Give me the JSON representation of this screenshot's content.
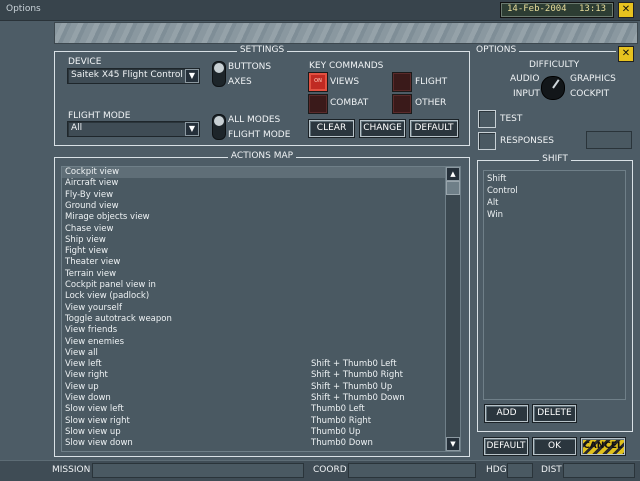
{
  "window": {
    "title": "Options",
    "date": "14-Feb-2004",
    "time": "13:13",
    "close_label": "✕"
  },
  "settings": {
    "title": "SETTINGS",
    "device_label": "DEVICE",
    "device_value": "Saitek X45 Flight Controller",
    "flight_mode_label": "FLIGHT MODE",
    "flight_mode_value": "All",
    "buttons_label": "BUTTONS",
    "axes_label": "AXES",
    "all_modes_label": "ALL MODES",
    "flight_mode_toggle_label": "FLIGHT MODE",
    "key_commands_label": "KEY COMMANDS",
    "on_label": "ON",
    "views_label": "VIEWS",
    "flight_label": "FLIGHT",
    "combat_label": "COMBAT",
    "other_label": "OTHER",
    "clear_label": "CLEAR",
    "change_label": "CHANGE",
    "default_label": "DEFAULT"
  },
  "options": {
    "title": "OPTIONS",
    "difficulty_label": "DIFFICULTY",
    "audio_label": "AUDIO",
    "graphics_label": "GRAPHICS",
    "input_label": "INPUT",
    "cockpit_label": "COCKPIT",
    "test_label": "TEST",
    "responses_label": "RESPONSES"
  },
  "actions_map": {
    "title": "ACTIONS MAP",
    "rows": [
      {
        "name": "Cockpit view",
        "key": ""
      },
      {
        "name": "Aircraft view",
        "key": ""
      },
      {
        "name": "Fly-By view",
        "key": ""
      },
      {
        "name": "Ground view",
        "key": ""
      },
      {
        "name": "Mirage objects view",
        "key": ""
      },
      {
        "name": "Chase view",
        "key": ""
      },
      {
        "name": "Ship view",
        "key": ""
      },
      {
        "name": "Fight view",
        "key": ""
      },
      {
        "name": "Theater view",
        "key": ""
      },
      {
        "name": "Terrain view",
        "key": ""
      },
      {
        "name": "Cockpit panel view in",
        "key": ""
      },
      {
        "name": "Lock view (padlock)",
        "key": ""
      },
      {
        "name": "View yourself",
        "key": ""
      },
      {
        "name": "Toggle autotrack weapon",
        "key": ""
      },
      {
        "name": "View friends",
        "key": ""
      },
      {
        "name": "View enemies",
        "key": ""
      },
      {
        "name": "View all",
        "key": ""
      },
      {
        "name": "View left",
        "key": "Shift + Thumb0 Left"
      },
      {
        "name": "View right",
        "key": "Shift + Thumb0 Right"
      },
      {
        "name": "View up",
        "key": "Shift + Thumb0 Up"
      },
      {
        "name": "View down",
        "key": "Shift + Thumb0 Down"
      },
      {
        "name": "Slow view left",
        "key": "Thumb0 Left"
      },
      {
        "name": "Slow view right",
        "key": "Thumb0 Right"
      },
      {
        "name": "Slow view up",
        "key": "Thumb0 Up"
      },
      {
        "name": "Slow view down",
        "key": "Thumb0 Down"
      }
    ]
  },
  "shift": {
    "title": "SHIFT",
    "items": [
      "Shift",
      "Control",
      "Alt",
      "Win"
    ],
    "add_label": "ADD",
    "delete_label": "DELETE"
  },
  "footer": {
    "default_label": "DEFAULT",
    "ok_label": "OK",
    "cancel_label": "CANCEL"
  },
  "statusbar": {
    "mission_label": "MISSION",
    "coord_label": "COORD",
    "hdg_label": "HDG",
    "dist_label": "DIST"
  }
}
